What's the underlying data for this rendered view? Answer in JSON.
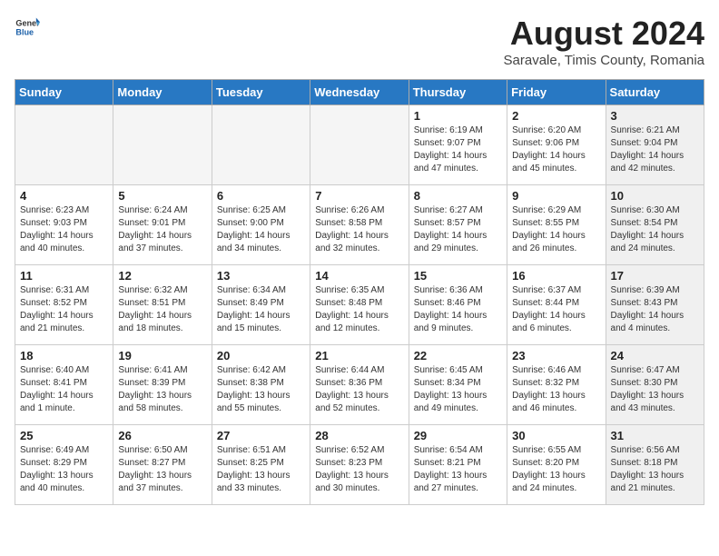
{
  "header": {
    "logo_general": "General",
    "logo_blue": "Blue",
    "month_year": "August 2024",
    "location": "Saravale, Timis County, Romania"
  },
  "days_of_week": [
    "Sunday",
    "Monday",
    "Tuesday",
    "Wednesday",
    "Thursday",
    "Friday",
    "Saturday"
  ],
  "weeks": [
    [
      {
        "day": "",
        "sunrise": "",
        "sunset": "",
        "daylight": "",
        "empty": true
      },
      {
        "day": "",
        "sunrise": "",
        "sunset": "",
        "daylight": "",
        "empty": true
      },
      {
        "day": "",
        "sunrise": "",
        "sunset": "",
        "daylight": "",
        "empty": true
      },
      {
        "day": "",
        "sunrise": "",
        "sunset": "",
        "daylight": "",
        "empty": true
      },
      {
        "day": "1",
        "sunrise": "Sunrise: 6:19 AM",
        "sunset": "Sunset: 9:07 PM",
        "daylight": "Daylight: 14 hours and 47 minutes.",
        "empty": false,
        "shaded": false
      },
      {
        "day": "2",
        "sunrise": "Sunrise: 6:20 AM",
        "sunset": "Sunset: 9:06 PM",
        "daylight": "Daylight: 14 hours and 45 minutes.",
        "empty": false,
        "shaded": false
      },
      {
        "day": "3",
        "sunrise": "Sunrise: 6:21 AM",
        "sunset": "Sunset: 9:04 PM",
        "daylight": "Daylight: 14 hours and 42 minutes.",
        "empty": false,
        "shaded": true
      }
    ],
    [
      {
        "day": "4",
        "sunrise": "Sunrise: 6:23 AM",
        "sunset": "Sunset: 9:03 PM",
        "daylight": "Daylight: 14 hours and 40 minutes.",
        "empty": false,
        "shaded": false
      },
      {
        "day": "5",
        "sunrise": "Sunrise: 6:24 AM",
        "sunset": "Sunset: 9:01 PM",
        "daylight": "Daylight: 14 hours and 37 minutes.",
        "empty": false,
        "shaded": false
      },
      {
        "day": "6",
        "sunrise": "Sunrise: 6:25 AM",
        "sunset": "Sunset: 9:00 PM",
        "daylight": "Daylight: 14 hours and 34 minutes.",
        "empty": false,
        "shaded": false
      },
      {
        "day": "7",
        "sunrise": "Sunrise: 6:26 AM",
        "sunset": "Sunset: 8:58 PM",
        "daylight": "Daylight: 14 hours and 32 minutes.",
        "empty": false,
        "shaded": false
      },
      {
        "day": "8",
        "sunrise": "Sunrise: 6:27 AM",
        "sunset": "Sunset: 8:57 PM",
        "daylight": "Daylight: 14 hours and 29 minutes.",
        "empty": false,
        "shaded": false
      },
      {
        "day": "9",
        "sunrise": "Sunrise: 6:29 AM",
        "sunset": "Sunset: 8:55 PM",
        "daylight": "Daylight: 14 hours and 26 minutes.",
        "empty": false,
        "shaded": false
      },
      {
        "day": "10",
        "sunrise": "Sunrise: 6:30 AM",
        "sunset": "Sunset: 8:54 PM",
        "daylight": "Daylight: 14 hours and 24 minutes.",
        "empty": false,
        "shaded": true
      }
    ],
    [
      {
        "day": "11",
        "sunrise": "Sunrise: 6:31 AM",
        "sunset": "Sunset: 8:52 PM",
        "daylight": "Daylight: 14 hours and 21 minutes.",
        "empty": false,
        "shaded": false
      },
      {
        "day": "12",
        "sunrise": "Sunrise: 6:32 AM",
        "sunset": "Sunset: 8:51 PM",
        "daylight": "Daylight: 14 hours and 18 minutes.",
        "empty": false,
        "shaded": false
      },
      {
        "day": "13",
        "sunrise": "Sunrise: 6:34 AM",
        "sunset": "Sunset: 8:49 PM",
        "daylight": "Daylight: 14 hours and 15 minutes.",
        "empty": false,
        "shaded": false
      },
      {
        "day": "14",
        "sunrise": "Sunrise: 6:35 AM",
        "sunset": "Sunset: 8:48 PM",
        "daylight": "Daylight: 14 hours and 12 minutes.",
        "empty": false,
        "shaded": false
      },
      {
        "day": "15",
        "sunrise": "Sunrise: 6:36 AM",
        "sunset": "Sunset: 8:46 PM",
        "daylight": "Daylight: 14 hours and 9 minutes.",
        "empty": false,
        "shaded": false
      },
      {
        "day": "16",
        "sunrise": "Sunrise: 6:37 AM",
        "sunset": "Sunset: 8:44 PM",
        "daylight": "Daylight: 14 hours and 6 minutes.",
        "empty": false,
        "shaded": false
      },
      {
        "day": "17",
        "sunrise": "Sunrise: 6:39 AM",
        "sunset": "Sunset: 8:43 PM",
        "daylight": "Daylight: 14 hours and 4 minutes.",
        "empty": false,
        "shaded": true
      }
    ],
    [
      {
        "day": "18",
        "sunrise": "Sunrise: 6:40 AM",
        "sunset": "Sunset: 8:41 PM",
        "daylight": "Daylight: 14 hours and 1 minute.",
        "empty": false,
        "shaded": false
      },
      {
        "day": "19",
        "sunrise": "Sunrise: 6:41 AM",
        "sunset": "Sunset: 8:39 PM",
        "daylight": "Daylight: 13 hours and 58 minutes.",
        "empty": false,
        "shaded": false
      },
      {
        "day": "20",
        "sunrise": "Sunrise: 6:42 AM",
        "sunset": "Sunset: 8:38 PM",
        "daylight": "Daylight: 13 hours and 55 minutes.",
        "empty": false,
        "shaded": false
      },
      {
        "day": "21",
        "sunrise": "Sunrise: 6:44 AM",
        "sunset": "Sunset: 8:36 PM",
        "daylight": "Daylight: 13 hours and 52 minutes.",
        "empty": false,
        "shaded": false
      },
      {
        "day": "22",
        "sunrise": "Sunrise: 6:45 AM",
        "sunset": "Sunset: 8:34 PM",
        "daylight": "Daylight: 13 hours and 49 minutes.",
        "empty": false,
        "shaded": false
      },
      {
        "day": "23",
        "sunrise": "Sunrise: 6:46 AM",
        "sunset": "Sunset: 8:32 PM",
        "daylight": "Daylight: 13 hours and 46 minutes.",
        "empty": false,
        "shaded": false
      },
      {
        "day": "24",
        "sunrise": "Sunrise: 6:47 AM",
        "sunset": "Sunset: 8:30 PM",
        "daylight": "Daylight: 13 hours and 43 minutes.",
        "empty": false,
        "shaded": true
      }
    ],
    [
      {
        "day": "25",
        "sunrise": "Sunrise: 6:49 AM",
        "sunset": "Sunset: 8:29 PM",
        "daylight": "Daylight: 13 hours and 40 minutes.",
        "empty": false,
        "shaded": false
      },
      {
        "day": "26",
        "sunrise": "Sunrise: 6:50 AM",
        "sunset": "Sunset: 8:27 PM",
        "daylight": "Daylight: 13 hours and 37 minutes.",
        "empty": false,
        "shaded": false
      },
      {
        "day": "27",
        "sunrise": "Sunrise: 6:51 AM",
        "sunset": "Sunset: 8:25 PM",
        "daylight": "Daylight: 13 hours and 33 minutes.",
        "empty": false,
        "shaded": false
      },
      {
        "day": "28",
        "sunrise": "Sunrise: 6:52 AM",
        "sunset": "Sunset: 8:23 PM",
        "daylight": "Daylight: 13 hours and 30 minutes.",
        "empty": false,
        "shaded": false
      },
      {
        "day": "29",
        "sunrise": "Sunrise: 6:54 AM",
        "sunset": "Sunset: 8:21 PM",
        "daylight": "Daylight: 13 hours and 27 minutes.",
        "empty": false,
        "shaded": false
      },
      {
        "day": "30",
        "sunrise": "Sunrise: 6:55 AM",
        "sunset": "Sunset: 8:20 PM",
        "daylight": "Daylight: 13 hours and 24 minutes.",
        "empty": false,
        "shaded": false
      },
      {
        "day": "31",
        "sunrise": "Sunrise: 6:56 AM",
        "sunset": "Sunset: 8:18 PM",
        "daylight": "Daylight: 13 hours and 21 minutes.",
        "empty": false,
        "shaded": true
      }
    ]
  ]
}
